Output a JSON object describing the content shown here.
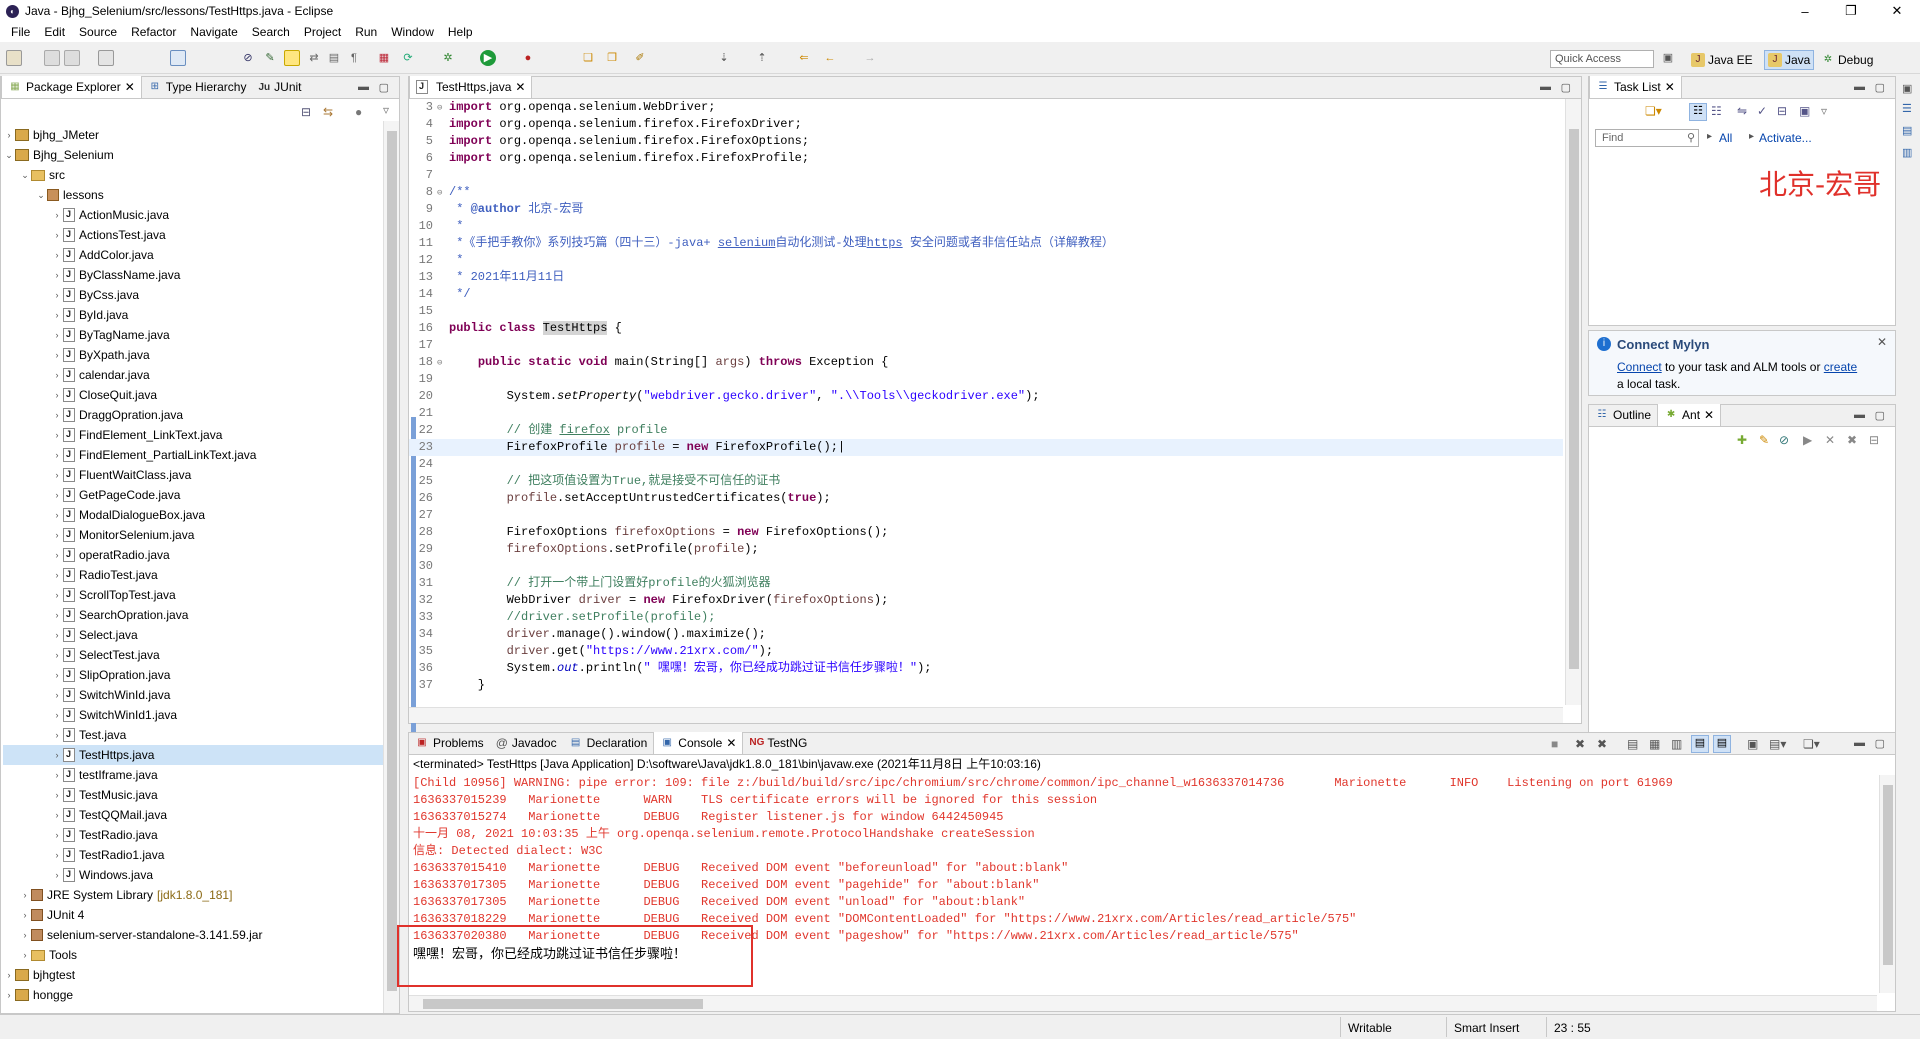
{
  "window": {
    "title": "Java - Bjhg_Selenium/src/lessons/TestHttps.java - Eclipse",
    "controls": [
      "–",
      "❐",
      "✕"
    ]
  },
  "menu": [
    "File",
    "Edit",
    "Source",
    "Refactor",
    "Navigate",
    "Search",
    "Project",
    "Run",
    "Window",
    "Help"
  ],
  "quick_access": {
    "placeholder": "Quick Access"
  },
  "perspectives": [
    {
      "label": "Java EE",
      "icon": "java-ee-icon"
    },
    {
      "label": "Java",
      "icon": "java-icon"
    },
    {
      "label": "Debug",
      "icon": "debug-icon"
    }
  ],
  "left_panel": {
    "tabs": [
      "Package Explorer",
      "Type Hierarchy",
      "JUnit"
    ],
    "tabs_icons": [
      "Ju"
    ],
    "tree": [
      {
        "level": 0,
        "arrow": "›",
        "icon": "proj",
        "label": "bjhg_JMeter"
      },
      {
        "level": 0,
        "arrow": "⌄",
        "icon": "proj",
        "label": "Bjhg_Selenium"
      },
      {
        "level": 1,
        "arrow": "⌄",
        "icon": "folder",
        "label": "src"
      },
      {
        "level": 2,
        "arrow": "⌄",
        "icon": "pkg",
        "label": "lessons"
      },
      {
        "level": 3,
        "arrow": "›",
        "icon": "jfile",
        "label": "ActionMusic.java"
      },
      {
        "level": 3,
        "arrow": "›",
        "icon": "jfile",
        "label": "ActionsTest.java"
      },
      {
        "level": 3,
        "arrow": "›",
        "icon": "jfile",
        "label": "AddColor.java"
      },
      {
        "level": 3,
        "arrow": "›",
        "icon": "jfile",
        "label": "ByClassName.java"
      },
      {
        "level": 3,
        "arrow": "›",
        "icon": "jfile",
        "label": "ByCss.java"
      },
      {
        "level": 3,
        "arrow": "›",
        "icon": "jfile",
        "label": "ById.java"
      },
      {
        "level": 3,
        "arrow": "›",
        "icon": "jfile",
        "label": "ByTagName.java"
      },
      {
        "level": 3,
        "arrow": "›",
        "icon": "jfile",
        "label": "ByXpath.java"
      },
      {
        "level": 3,
        "arrow": "›",
        "icon": "jfile",
        "label": "calendar.java"
      },
      {
        "level": 3,
        "arrow": "›",
        "icon": "jfile",
        "label": "CloseQuit.java"
      },
      {
        "level": 3,
        "arrow": "›",
        "icon": "jfile",
        "label": "DraggOpration.java"
      },
      {
        "level": 3,
        "arrow": "›",
        "icon": "jfile",
        "label": "FindElement_LinkText.java"
      },
      {
        "level": 3,
        "arrow": "›",
        "icon": "jfile",
        "label": "FindElement_PartialLinkText.java"
      },
      {
        "level": 3,
        "arrow": "›",
        "icon": "jfile",
        "label": "FluentWaitClass.java"
      },
      {
        "level": 3,
        "arrow": "›",
        "icon": "jfile",
        "label": "GetPageCode.java"
      },
      {
        "level": 3,
        "arrow": "›",
        "icon": "jfile",
        "label": "ModalDialogueBox.java"
      },
      {
        "level": 3,
        "arrow": "›",
        "icon": "jfile",
        "label": "MonitorSelenium.java"
      },
      {
        "level": 3,
        "arrow": "›",
        "icon": "jfile",
        "label": "operatRadio.java"
      },
      {
        "level": 3,
        "arrow": "›",
        "icon": "jfile",
        "label": "RadioTest.java"
      },
      {
        "level": 3,
        "arrow": "›",
        "icon": "jfile",
        "label": "ScrollTopTest.java"
      },
      {
        "level": 3,
        "arrow": "›",
        "icon": "jfile",
        "label": "SearchOpration.java"
      },
      {
        "level": 3,
        "arrow": "›",
        "icon": "jfile",
        "label": "Select.java"
      },
      {
        "level": 3,
        "arrow": "›",
        "icon": "jfile",
        "label": "SelectTest.java"
      },
      {
        "level": 3,
        "arrow": "›",
        "icon": "jfile",
        "label": "SlipOpration.java"
      },
      {
        "level": 3,
        "arrow": "›",
        "icon": "jfile",
        "label": "SwitchWinId.java"
      },
      {
        "level": 3,
        "arrow": "›",
        "icon": "jfile",
        "label": "SwitchWinId1.java"
      },
      {
        "level": 3,
        "arrow": "›",
        "icon": "jfile",
        "label": "Test.java"
      },
      {
        "level": 3,
        "arrow": "›",
        "icon": "jfile",
        "label": "TestHttps.java",
        "selected": true
      },
      {
        "level": 3,
        "arrow": "›",
        "icon": "jfile",
        "label": "testIframe.java"
      },
      {
        "level": 3,
        "arrow": "›",
        "icon": "jfile",
        "label": "TestMusic.java"
      },
      {
        "level": 3,
        "arrow": "›",
        "icon": "jfile",
        "label": "TestQQMail.java"
      },
      {
        "level": 3,
        "arrow": "›",
        "icon": "jfile",
        "label": "TestRadio.java"
      },
      {
        "level": 3,
        "arrow": "›",
        "icon": "jfile",
        "label": "TestRadio1.java"
      },
      {
        "level": 3,
        "arrow": "›",
        "icon": "jfile",
        "label": "Windows.java"
      },
      {
        "level": 1,
        "arrow": "›",
        "icon": "jar",
        "label": "JRE System Library",
        "extra": "[jdk1.8.0_181]"
      },
      {
        "level": 1,
        "arrow": "›",
        "icon": "jar",
        "label": "JUnit 4"
      },
      {
        "level": 1,
        "arrow": "›",
        "icon": "jar",
        "label": "selenium-server-standalone-3.141.59.jar"
      },
      {
        "level": 1,
        "arrow": "›",
        "icon": "folder",
        "label": "Tools"
      },
      {
        "level": 0,
        "arrow": "›",
        "icon": "proj",
        "label": "bjhgtest"
      },
      {
        "level": 0,
        "arrow": "›",
        "icon": "proj",
        "label": "hongge"
      }
    ]
  },
  "editor": {
    "tab": "TestHttps.java",
    "lines": [
      {
        "n": "3",
        "marker": "⊖",
        "html": "<span class='kw'>import</span> org.openqa.selenium.WebDriver;"
      },
      {
        "n": "4",
        "html": "<span class='kw'>import</span> org.openqa.selenium.firefox.FirefoxDriver;"
      },
      {
        "n": "5",
        "html": "<span class='kw'>import</span> org.openqa.selenium.firefox.FirefoxOptions;"
      },
      {
        "n": "6",
        "html": "<span class='kw'>import</span> org.openqa.selenium.firefox.FirefoxProfile;"
      },
      {
        "n": "7",
        "html": ""
      },
      {
        "n": "8",
        "marker": "⊖",
        "html": "<span class='jd'>/**</span>"
      },
      {
        "n": "9",
        "html": "<span class='jd'> * <b>@author</b> 北京-宏哥</span>"
      },
      {
        "n": "10",
        "html": "<span class='jd'> *</span>"
      },
      {
        "n": "11",
        "html": "<span class='jd'> *《手把手教你》系列技巧篇（四十三）-java+ <u>selenium</u>自动化测试-处理<u>https</u> 安全问题或者非信任站点（详解教程）</span>"
      },
      {
        "n": "12",
        "html": "<span class='jd'> *</span>"
      },
      {
        "n": "13",
        "html": "<span class='jd'> * 2021年11月11日</span>"
      },
      {
        "n": "14",
        "html": "<span class='jd'> */</span>"
      },
      {
        "n": "15",
        "html": ""
      },
      {
        "n": "16",
        "html": "<span class='kw'>public class</span> <span style='background:#d4d4d4'>TestHttps</span> {"
      },
      {
        "n": "17",
        "html": ""
      },
      {
        "n": "18",
        "marker": "⊖",
        "html": "    <span class='kw'>public static void</span> main(String[] <span class='var'>args</span>) <span class='kw'>throws</span> Exception {"
      },
      {
        "n": "19",
        "html": ""
      },
      {
        "n": "20",
        "html": "        System.<i>setProperty</i>(<span class='str'>\"webdriver.gecko.driver\"</span>, <span class='str'>\".\\\\Tools\\\\geckodriver.exe\"</span>);"
      },
      {
        "n": "21",
        "html": ""
      },
      {
        "n": "22",
        "html": "        <span class='cm'>// 创建 <u>firefox</u> profile</span>"
      },
      {
        "n": "23",
        "current": true,
        "html": "        FirefoxProfile <span class='var'>profile</span> = <span class='kw'>new</span> FirefoxProfile();|"
      },
      {
        "n": "24",
        "html": ""
      },
      {
        "n": "25",
        "html": "        <span class='cm'>// 把这项值设置为True,就是接受不可信任的证书</span>"
      },
      {
        "n": "26",
        "html": "        <span class='var'>profile</span>.setAcceptUntrustedCertificates(<span class='kw'>true</span>);"
      },
      {
        "n": "27",
        "html": ""
      },
      {
        "n": "28",
        "html": "        FirefoxOptions <span class='var'>firefoxOptions</span> = <span class='kw'>new</span> FirefoxOptions();"
      },
      {
        "n": "29",
        "html": "        <span class='var'>firefoxOptions</span>.setProfile(<span class='var'>profile</span>);"
      },
      {
        "n": "30",
        "html": ""
      },
      {
        "n": "31",
        "html": "        <span class='cm'>// 打开一个带上门设置好profile的火狐浏览器</span>"
      },
      {
        "n": "32",
        "html": "        WebDriver <span class='var'>driver</span> = <span class='kw'>new</span> FirefoxDriver(<span class='var'>firefoxOptions</span>);"
      },
      {
        "n": "33",
        "html": "        <span class='cm'>//driver.setProfile(profile);</span>"
      },
      {
        "n": "34",
        "html": "        <span class='var'>driver</span>.manage().window().maximize();"
      },
      {
        "n": "35",
        "html": "        <span class='var'>driver</span>.get(<span class='str'>\"https://www.21xrx.com/\"</span>);"
      },
      {
        "n": "36",
        "html": "        System.<span class='fld'><i>out</i></span>.println(<span class='str'>\" 嘿嘿！宏哥，你已经成功跳过证书信任步骤啦！\"</span>);"
      },
      {
        "n": "37",
        "html": "    }"
      }
    ]
  },
  "task_list": {
    "tab": "Task List",
    "find_placeholder": "Find",
    "all": "All",
    "activate": "Activate...",
    "watermark": "北京-宏哥"
  },
  "mylyn": {
    "title": "Connect Mylyn",
    "connect": "Connect",
    "text1": " to your task and ALM tools or ",
    "create": "create",
    "text2": "a local task."
  },
  "outline": {
    "tabs": [
      "Outline",
      "Ant"
    ]
  },
  "bottom": {
    "tabs": [
      "Problems",
      "Javadoc",
      "Declaration",
      "Console",
      "TestNG"
    ],
    "header": "<terminated> TestHttps [Java Application] D:\\software\\Java\\jdk1.8.0_181\\bin\\javaw.exe (2021年11月8日 上午10:03:16)",
    "lines": [
      {
        "c": "red",
        "t": "[Child 10956] WARNING: pipe error: 109: file z:/build/build/src/ipc/chromium/src/chrome/common/ipc_channel_win.cc, line 341"
      },
      {
        "c": "red",
        "t": "1636337015239   Marionette      WARN    TLS certificate errors will be ignored for this session"
      },
      {
        "c": "red",
        "t": "1636337015274   Marionette      DEBUG   Register listener.js for window 6442450945"
      },
      {
        "c": "red",
        "t": "十一月 08, 2021 10:03:35 上午 org.openqa.selenium.remote.ProtocolHandshake createSession"
      },
      {
        "c": "red",
        "t": "信息: Detected dialect: W3C"
      },
      {
        "c": "red",
        "t": "1636337015410   Marionette      DEBUG   Received DOM event \"beforeunload\" for \"about:blank\""
      },
      {
        "c": "red",
        "t": "1636337017305   Marionette      DEBUG   Received DOM event \"pagehide\" for \"about:blank\""
      },
      {
        "c": "red",
        "t": "1636337017305   Marionette      DEBUG   Received DOM event \"unload\" for \"about:blank\""
      },
      {
        "c": "red",
        "t": "1636337018229   Marionette      DEBUG   Received DOM event \"DOMContentLoaded\" for \"https://www.21xrx.com/Articles/read_article/575\""
      },
      {
        "c": "red",
        "t": "1636337020380   Marionette      DEBUG   Received DOM event \"pageshow\" for \"https://www.21xrx.com/Articles/read_article/575\""
      },
      {
        "c": "blk",
        "t": "嘿嘿！宏哥，你已经成功跳过证书信任步骤啦！"
      }
    ],
    "first_line_tail": "Marionette      INFO    Listening on port 61969",
    "first_line_head": "[Child 10956] WARNING: pipe error: 109: file z:/build/build/src/ipc/chromium/src/chrome/common/ipc_channel_w1636337014736"
  },
  "status": {
    "writable": "Writable",
    "insert": "Smart Insert",
    "position": "23 : 55"
  },
  "colors": {
    "highlight_box": "#e0312b",
    "selection": "#cde3f7",
    "watermark": "#e0312b",
    "link": "#0645ad"
  }
}
